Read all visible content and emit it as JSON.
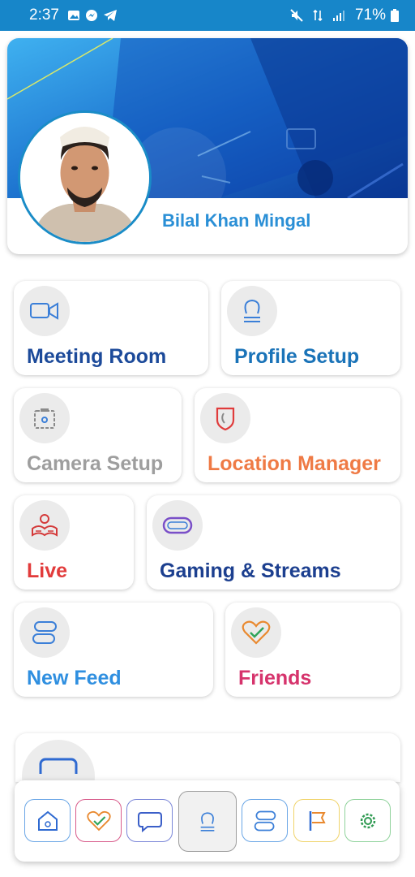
{
  "status_bar": {
    "time": "2:37",
    "battery": "71%"
  },
  "profile": {
    "name": "Bilal Khan Mingal"
  },
  "tiles": [
    {
      "label": "Meeting Room",
      "icon": "video-camera-icon",
      "color": "#1c4a9a"
    },
    {
      "label": "Profile Setup",
      "icon": "profile-icon",
      "color": "#1a73b8"
    },
    {
      "label": "Camera Setup",
      "icon": "camera-icon",
      "color": "#9e9e9e"
    },
    {
      "label": "Location Manager",
      "icon": "location-icon",
      "color": "#ef7a45"
    },
    {
      "label": "Live",
      "icon": "live-reader-icon",
      "color": "#e23b3b"
    },
    {
      "label": "Gaming & Streams",
      "icon": "gamepad-icon",
      "color": "#1c3f8f"
    },
    {
      "label": "New Feed",
      "icon": "feed-icon",
      "color": "#2f8fe0"
    },
    {
      "label": "Friends",
      "icon": "heart-check-icon",
      "color": "#d6336c"
    }
  ],
  "bottom_nav": [
    {
      "icon": "home-icon",
      "border": "#6aa6e6"
    },
    {
      "icon": "heart-check-icon",
      "border": "#d85a8a"
    },
    {
      "icon": "chat-bubble-icon",
      "border": "#7a86d8"
    },
    {
      "icon": "profile-icon",
      "border": "#9d9d9d",
      "active": true
    },
    {
      "icon": "feed-icon",
      "border": "#6aa6e6"
    },
    {
      "icon": "flag-icon",
      "border": "#f0d36a"
    },
    {
      "icon": "settings-gear-icon",
      "border": "#8fd29b"
    }
  ],
  "colors": {
    "status_bar": "#1786c9",
    "accent": "#2a8fd6"
  }
}
